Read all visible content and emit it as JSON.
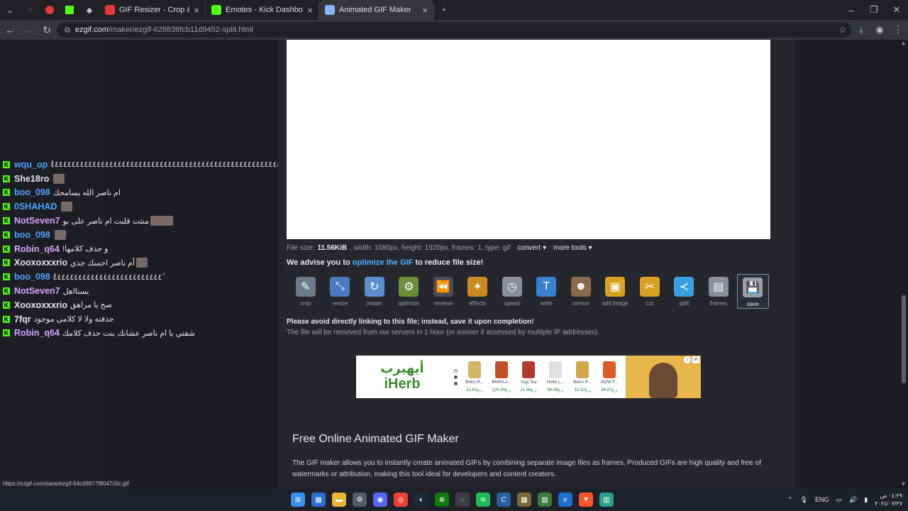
{
  "browser": {
    "tabs": [
      {
        "title": "GIF Resizer - Crop & Resize Ani",
        "active": false,
        "icon_color": "#e53935"
      },
      {
        "title": "Emotes - Kick Dashboard",
        "active": false,
        "icon_color": "#53fc18"
      },
      {
        "title": "Animated GIF Maker",
        "active": true,
        "icon_color": "#8ab4f8"
      }
    ],
    "url_host": "ezgif.com",
    "url_path": "/maker/ezgif-628838fcb11d9452-split.html",
    "status_url": "https://ezgif.com/save/ezgif-64cd9977f8047c5c.gif"
  },
  "chat": [
    {
      "user": "wqu_op",
      "color": "#4fa3ff",
      "msg": "ٔ٤٤٤٤٤٤٤٤٤٤٤٤٤٤٤٤٤٤٤٤٤٤٤٤٤٤٤٤٤٤٤٤٤٤٤٤٤٤٤٤٤٤٤٤٤٤٤٤٤٤٤٤٤٤٤٤٤٤٤٤ٔ",
      "emote": ""
    },
    {
      "user": "She18ro",
      "color": "#e6e6e6",
      "msg": "",
      "emote": "single"
    },
    {
      "user": "boo_098",
      "color": "#4fa3ff",
      "msg": "ام ناصر الله يسامحك",
      "emote": ""
    },
    {
      "user": "0SHAHAD",
      "color": "#4fa3ff",
      "msg": "",
      "emote": "single"
    },
    {
      "user": "NotSeven7",
      "color": "#d7a4ff",
      "msg": "منتت قلبت ام ناصر على بو",
      "emote": "wide"
    },
    {
      "user": "boo_098",
      "color": "#4fa3ff",
      "msg": "",
      "emote": "single"
    },
    {
      "user": "Robin_q64",
      "color": "#d7a4ff",
      "msg": "!و حذف كلامها",
      "emote": ""
    },
    {
      "user": "Xooxoxxxrio",
      "color": "#e6e6e6",
      "msg": "أم ناصر احسك جذي",
      "emote": "single"
    },
    {
      "user": "boo_098",
      "color": "#4fa3ff",
      "msg": "ٔ٤٤٤٤٤٤٤٤٤٤٤٤٤٤٤٤٤٤٤٤٤٤٤٤٤٤ٔ",
      "emote": ""
    },
    {
      "user": "NotSeven7",
      "color": "#d7a4ff",
      "msg": "يستااهل",
      "emote": ""
    },
    {
      "user": "Xooxoxxxrio",
      "color": "#e6e6e6",
      "msg": "صح يا مراهق",
      "emote": ""
    },
    {
      "user": "7fqr",
      "color": "#e6e6e6",
      "msg": "حذفته ولا لا كلامي موجود",
      "emote": ""
    },
    {
      "user": "Robin_q64",
      "color": "#d7a4ff",
      "msg": "شفتي يا ام ناصر عشانك بنت حذف كلامك",
      "emote": ""
    }
  ],
  "fileinfo": {
    "prefix": "File size:",
    "size": "11.56KiB",
    "rest": ", width: 1080px, height: 1920px, frames: 1, type: gif",
    "convert": "convert ▾",
    "more_tools": "more tools ▾"
  },
  "advice": {
    "pre": "We advise you to ",
    "link": "optimize the GIF",
    "post": " to reduce file size!"
  },
  "tools": [
    {
      "label": "crop",
      "icon": "crop-icon",
      "glyph": "✎",
      "color": "#6b7b8c"
    },
    {
      "label": "resize",
      "icon": "resize-icon",
      "glyph": "⤡",
      "color": "#4a78c2"
    },
    {
      "label": "rotate",
      "icon": "rotate-icon",
      "glyph": "↻",
      "color": "#5a8fcf"
    },
    {
      "label": "optimize",
      "icon": "optimize-icon",
      "glyph": "⚙",
      "color": "#6b8f3a"
    },
    {
      "label": "reverse",
      "icon": "reverse-icon",
      "glyph": "⏪",
      "color": "#4a4d55"
    },
    {
      "label": "effects",
      "icon": "effects-icon",
      "glyph": "✦",
      "color": "#c98a22"
    },
    {
      "label": "speed",
      "icon": "speed-icon",
      "glyph": "◷",
      "color": "#8a8f98"
    },
    {
      "label": "write",
      "icon": "write-icon",
      "glyph": "T",
      "color": "#3a7fd0"
    },
    {
      "label": "censor",
      "icon": "censor-icon",
      "glyph": "☻",
      "color": "#8a6a4a"
    },
    {
      "label": "add image",
      "icon": "add-image-icon",
      "glyph": "▣",
      "color": "#d9a222"
    },
    {
      "label": "cut",
      "icon": "cut-icon",
      "glyph": "✂",
      "color": "#d9a222"
    },
    {
      "label": "split",
      "icon": "split-icon",
      "glyph": "≺",
      "color": "#3aa0e0"
    },
    {
      "label": "frames",
      "icon": "frames-icon",
      "glyph": "▤",
      "color": "#8a8f98"
    },
    {
      "label": "save",
      "icon": "save-icon",
      "glyph": "💾",
      "color": "#9aa0a6"
    }
  ],
  "selected_tool": "save",
  "warn1": "Please avoid directly linking to this file; instead, save it upon completion!",
  "warn2": "The file will be removed from our servers in 1 hour (or sooner if accessed by multiple IP addresses).",
  "ad": {
    "logo_ar": "أيهيرب",
    "logo_en": "iHerb",
    "products": [
      {
        "name": "Bob's R...",
        "price": "21.61ر.ع",
        "color": "#d4b46a"
      },
      {
        "name": "BNRG,J...",
        "price": "120.93ر.ع",
        "color": "#c0502a"
      },
      {
        "name": "Yogi Tea",
        "price": "21.46ر.ع",
        "color": "#b03a2e"
      },
      {
        "name": "Hobe L...",
        "price": "56.08ر.ع",
        "color": "#e0e0e0"
      },
      {
        "name": "Bob's R...",
        "price": "32.42ر.ع",
        "color": "#d4a84a"
      },
      {
        "name": "NOW F...",
        "price": "56.67ر.ع",
        "color": "#e05a2a"
      }
    ]
  },
  "section": {
    "title": "Free Online Animated GIF Maker",
    "text": "The GIF maker allows you to instantly create animated GIFs by combining separate image files as frames. Produced GIFs are high quality and free of watermarks or attribution, making this tool ideal for developers and content creators."
  },
  "tray": {
    "lang": "ENG",
    "time": "٠٤:٢٩ ص",
    "date": "٢٠٢٤/٠٧/٢٧"
  },
  "taskbar_apps": [
    {
      "name": "windows-start-icon",
      "color": "#3a8fe8",
      "glyph": "⊞"
    },
    {
      "name": "store-icon",
      "color": "#2a6fd0",
      "glyph": "▦"
    },
    {
      "name": "file-explorer-icon",
      "color": "#e8b634",
      "glyph": "▬"
    },
    {
      "name": "settings-icon",
      "color": "#5a5d65",
      "glyph": "⚙"
    },
    {
      "name": "discord-icon",
      "color": "#5865f2",
      "glyph": "◉"
    },
    {
      "name": "chrome-icon",
      "color": "#e94235",
      "glyph": "◎"
    },
    {
      "name": "steam-icon",
      "color": "#1b2838",
      "glyph": "◐"
    },
    {
      "name": "xbox-icon",
      "color": "#107c10",
      "glyph": "⊗"
    },
    {
      "name": "recorder-icon",
      "color": "#3a3d45",
      "glyph": "◌"
    },
    {
      "name": "spotify-icon",
      "color": "#1db954",
      "glyph": "≋"
    },
    {
      "name": "ccleaner-icon",
      "color": "#2a5fa0",
      "glyph": "C"
    },
    {
      "name": "app-icon",
      "color": "#7a6a3a",
      "glyph": "▩"
    },
    {
      "name": "photos-icon",
      "color": "#3a7a3a",
      "glyph": "▨"
    },
    {
      "name": "edge-icon",
      "color": "#1a6fd0",
      "glyph": "e"
    },
    {
      "name": "brave-icon",
      "color": "#fb542b",
      "glyph": "▼"
    },
    {
      "name": "audio-app-icon",
      "color": "#2a9f8a",
      "glyph": "▥"
    }
  ]
}
